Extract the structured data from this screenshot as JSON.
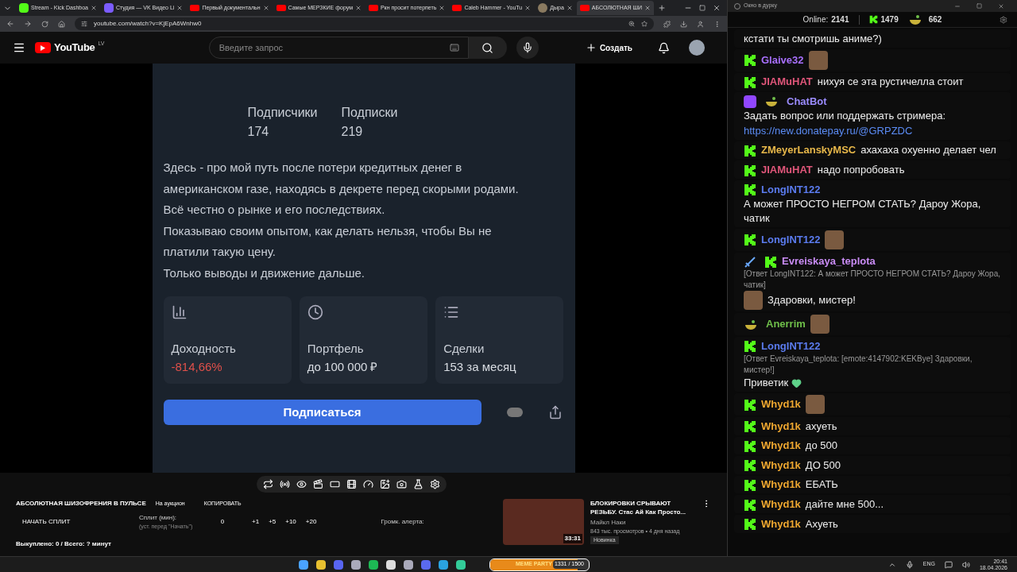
{
  "browser": {
    "tabs": [
      {
        "title": "Stream - Kick Dashboa",
        "kind": "kick",
        "selected": false
      },
      {
        "title": "Студия — VK Видео Li",
        "kind": "vk",
        "selected": false
      },
      {
        "title": "Первый документальн",
        "kind": "youtube",
        "selected": false
      },
      {
        "title": "Самые МЕРЗКИЕ форум",
        "kind": "youtube",
        "selected": false
      },
      {
        "title": "Ркн просит потерпеть",
        "kind": "youtube",
        "selected": false
      },
      {
        "title": "Caleb Hammer - YouTu",
        "kind": "youtube",
        "selected": false
      },
      {
        "title": "Дыра",
        "kind": "avatar",
        "selected": false
      },
      {
        "title": "АБСОЛЮТНАЯ ШИ",
        "kind": "youtube",
        "selected": true
      }
    ],
    "address": "youtube.com/watch?v=KjEpA6Wnhw0"
  },
  "youtube": {
    "logo": "YouTube",
    "region": "LV",
    "search_placeholder": "Введите запрос",
    "create": "Создать"
  },
  "video": {
    "stats": [
      {
        "label": "Подписчики",
        "value": "174"
      },
      {
        "label": "Подписки",
        "value": "219"
      }
    ],
    "description": [
      "Здесь - про мой путь после потери кредитных денег в американском газе, находясь в декрете перед скорыми родами.",
      "Всё честно о рынке и его последствиях.",
      "Показываю своим опытом, как делать нельзя, чтобы Вы не платили такую цену.",
      "Только выводы и движение дальше."
    ],
    "cards": [
      {
        "kind": "bars",
        "label": "Доходность",
        "value": "-814,66%",
        "negative": true
      },
      {
        "kind": "pie",
        "label": "Портфель",
        "value": "до 100 000 ₽",
        "negative": false
      },
      {
        "kind": "list",
        "label": "Сделки",
        "value": "153 за месяц",
        "negative": false
      }
    ],
    "subscribe": "Подписаться"
  },
  "panel": {
    "title": "АБСОЛЮТНАЯ ШИЗОФРЕНИЯ В ПУЛЬСЕ",
    "auction": "На аукцион",
    "copy": "КОПИРОВАТЬ",
    "split_button": "НАЧАТЬ СПЛИТ",
    "split_label": "Сплит (мин):",
    "split_hint": "(уст. перед \"Начать\")",
    "split_value": "0",
    "increments": [
      "+1",
      "+5",
      "+10",
      "+20"
    ],
    "alert_volume": "Громк. алерта:",
    "bought": "Выкуплено: 0 / Всего: ? минут"
  },
  "recommended": {
    "duration": "33:31",
    "title": "БЛОКИРОВКИ СРЫВАЮТ РЕЗЬБУ. Стас Ай Как Просто...",
    "channel": "Майкл Наки",
    "meta": "843 тыс. просмотров • 4 дня назад",
    "badge": "Новинка"
  },
  "chat": {
    "window_title": "Окно в дурку",
    "online_label": "Online:",
    "online": "2141",
    "kick_count": "1479",
    "other_count": "662",
    "messages": [
      {
        "parts": [
          {
            "kind": "text",
            "text": "кстати ты смотришь аниме?)"
          }
        ]
      },
      {
        "badges": [
          {
            "kind": "kick"
          }
        ],
        "user": "Glaive32",
        "color": "#a970ff",
        "parts": [
          {
            "kind": "emote"
          }
        ]
      },
      {
        "badges": [
          {
            "kind": "kick"
          }
        ],
        "user": "JIAMuHAT",
        "color": "#e0567a",
        "parts": [
          {
            "kind": "text",
            "text": "нихуя се эта рустичелла стоит"
          }
        ]
      },
      {
        "badges": [
          {
            "kind": "bot"
          },
          {
            "kind": "bowl"
          }
        ],
        "user": "ChatBot",
        "color": "#9b8cff",
        "parts": [
          {
            "kind": "text",
            "text": "Задать вопрос или поддержать стримера:"
          },
          {
            "kind": "link",
            "text": "https://new.donatepay.ru/@GRPZDC"
          }
        ]
      },
      {
        "badges": [
          {
            "kind": "kick"
          }
        ],
        "user": "ZMeyerLanskyMSC",
        "color": "#e8b84a",
        "parts": [
          {
            "kind": "text",
            "text": "ахахаха охуенно делает чел"
          }
        ]
      },
      {
        "badges": [
          {
            "kind": "kick"
          }
        ],
        "user": "JIAMuHAT",
        "color": "#e0567a",
        "parts": [
          {
            "kind": "text",
            "text": "надо попробовать"
          }
        ]
      },
      {
        "badges": [
          {
            "kind": "kick"
          }
        ],
        "user": "LongINT122",
        "color": "#5b7cf0",
        "parts": [
          {
            "kind": "text",
            "text": "А может ПРОСТО НЕГРОМ СТАТЬ? Дароу Жора, чатик"
          }
        ]
      },
      {
        "badges": [
          {
            "kind": "kick"
          }
        ],
        "user": "LongINT122",
        "color": "#5b7cf0",
        "parts": [
          {
            "kind": "emote"
          }
        ]
      },
      {
        "badges": [
          {
            "kind": "sword"
          },
          {
            "kind": "kick"
          }
        ],
        "user": "Evreiskaya_teplota",
        "color": "#c98cf5",
        "reply": "[Ответ LongINT122: А может ПРОСТО НЕГРОМ СТАТЬ? Дароу Жора, чатик]",
        "parts": [
          {
            "kind": "emote"
          },
          {
            "kind": "text",
            "text": "Здаровки, мистер!"
          }
        ]
      },
      {
        "badges": [
          {
            "kind": "bowl"
          }
        ],
        "user": "Anerrim",
        "color": "#6fbf4a",
        "parts": [
          {
            "kind": "emote"
          }
        ]
      },
      {
        "badges": [
          {
            "kind": "kick"
          }
        ],
        "user": "LongINT122",
        "color": "#5b7cf0",
        "reply": "[Ответ Evreiskaya_teplota: [emote:4147902:KEKBye] Здаровки, мистер!]",
        "parts": [
          {
            "kind": "text",
            "text": "Приветик"
          },
          {
            "kind": "heart"
          }
        ]
      },
      {
        "badges": [
          {
            "kind": "kick"
          }
        ],
        "user": "Whyd1k",
        "color": "#f0a830",
        "parts": [
          {
            "kind": "emote"
          }
        ]
      },
      {
        "badges": [
          {
            "kind": "kick"
          }
        ],
        "user": "Whyd1k",
        "color": "#f0a830",
        "parts": [
          {
            "kind": "text",
            "text": "ахуеть"
          }
        ]
      },
      {
        "badges": [
          {
            "kind": "kick"
          }
        ],
        "user": "Whyd1k",
        "color": "#f0a830",
        "parts": [
          {
            "kind": "text",
            "text": "до 500"
          }
        ]
      },
      {
        "badges": [
          {
            "kind": "kick"
          }
        ],
        "user": "Whyd1k",
        "color": "#f0a830",
        "parts": [
          {
            "kind": "text",
            "text": "ДО 500"
          }
        ]
      },
      {
        "badges": [
          {
            "kind": "kick"
          }
        ],
        "user": "Whyd1k",
        "color": "#f0a830",
        "parts": [
          {
            "kind": "text",
            "text": "ЕБАТЬ"
          }
        ]
      },
      {
        "badges": [
          {
            "kind": "kick"
          }
        ],
        "user": "Whyd1k",
        "color": "#f0a830",
        "parts": [
          {
            "kind": "text",
            "text": "дайте мне 500..."
          }
        ]
      },
      {
        "badges": [
          {
            "kind": "kick"
          }
        ],
        "user": "Whyd1k",
        "color": "#f0a830",
        "parts": [
          {
            "kind": "text",
            "text": "Ахуеть"
          }
        ]
      }
    ]
  },
  "taskbar": {
    "widget_title": "MEME PARTY",
    "widget_count": "1331 / 1500",
    "level": 0.89,
    "language": "ENG",
    "time": "20:41",
    "date": "18.04.2026"
  }
}
